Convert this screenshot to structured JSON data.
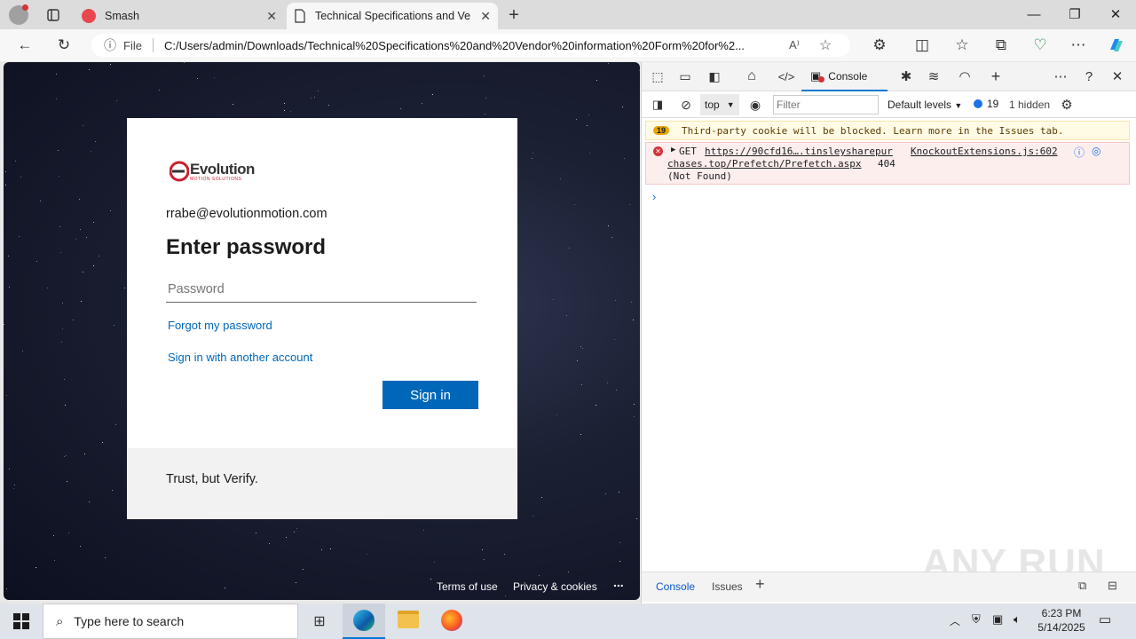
{
  "browser": {
    "tabs": [
      {
        "label": "Smash"
      },
      {
        "label": "Technical Specifications and Ven"
      }
    ],
    "url_prefix": "File",
    "url": "C:/Users/admin/Downloads/Technical%20Specifications%20and%20Vendor%20information%20Form%20for%2..."
  },
  "login": {
    "logo_text": "Evolution",
    "logo_sub": "MOTION SOLUTIONS",
    "email": "rrabe@evolutionmotion.com",
    "heading": "Enter password",
    "password_placeholder": "Password",
    "forgot_link": "Forgot my password",
    "another_account_link": "Sign in with another account",
    "signin_button": "Sign in",
    "footer_text": "Trust, but Verify."
  },
  "page_footer": {
    "terms": "Terms of use",
    "privacy": "Privacy & cookies",
    "more": "..."
  },
  "devtools": {
    "console_tab": "Console",
    "context": "top",
    "filter_placeholder": "Filter",
    "levels": "Default levels",
    "issues_count": "19",
    "hidden": "1 hidden",
    "warning": {
      "count": "19",
      "text": "Third-party cookie will be blocked. Learn more in the Issues tab."
    },
    "error": {
      "method": "GET",
      "url1": "https://90cfd16….tinsleysharepur",
      "source": "KnockoutExtensions.js:602",
      "url2": "chases.top/Prefetch/Prefetch.aspx",
      "status": "404",
      "status_text": "(Not Found)"
    },
    "drawer_tabs": [
      "Console",
      "Issues"
    ]
  },
  "watermark": "ANY RUN",
  "taskbar": {
    "search_placeholder": "Type here to search",
    "time": "6:23 PM",
    "date": "5/14/2025"
  },
  "colors": {
    "signin_blue": "#0067b8",
    "link_blue": "#0067b8",
    "accent": "#0078d4"
  }
}
